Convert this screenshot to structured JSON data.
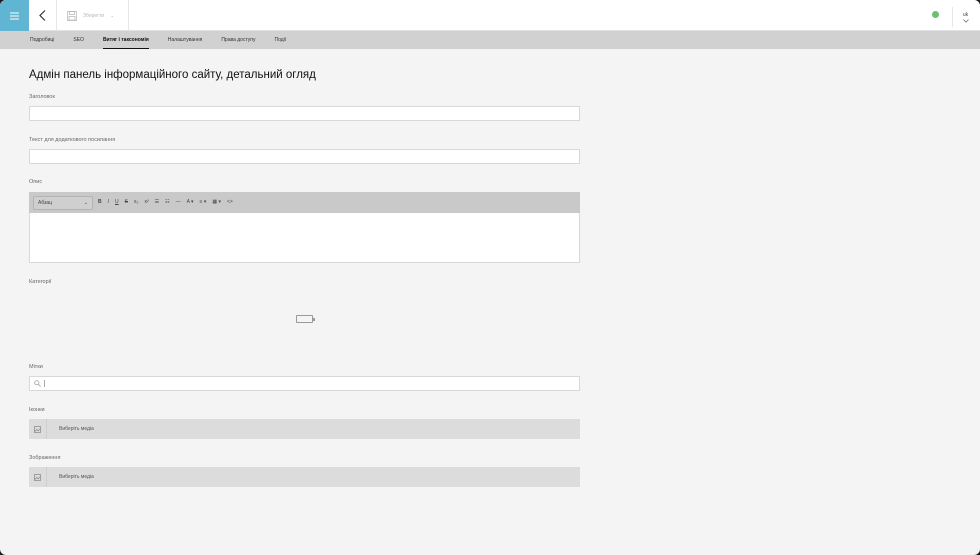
{
  "topbar": {
    "save_label": "Зберегти",
    "language": "uk",
    "status_color": "#6cc070",
    "accent_color": "#5fb5d2"
  },
  "tabs": [
    {
      "label": "Подробиці",
      "active": false
    },
    {
      "label": "SEO",
      "active": false
    },
    {
      "label": "Витяг і таксономія",
      "active": true
    },
    {
      "label": "Налаштування",
      "active": false
    },
    {
      "label": "Права доступу",
      "active": false
    },
    {
      "label": "Події",
      "active": false
    }
  ],
  "page": {
    "title": "Адмін панель інформаційного сайту, детальний огляд"
  },
  "fields": {
    "heading_label": "Заголовок",
    "extra_link_label": "Текст для додаткового посилання",
    "description_label": "Опис",
    "categories_label": "Категорії",
    "tags_label": "Мітки",
    "icons_label": "Іконки",
    "images_label": "Зображення"
  },
  "editor": {
    "format": "Абзац",
    "buttons": [
      "B",
      "I",
      "U",
      "S",
      "x₂",
      "x²",
      "☰",
      "☷",
      "—",
      "A ▾",
      "≡ ▾",
      "▦ ▾",
      "<>"
    ]
  },
  "media": {
    "icons_button": "Виберіть медіа",
    "images_button": "Виберіть медіа"
  }
}
